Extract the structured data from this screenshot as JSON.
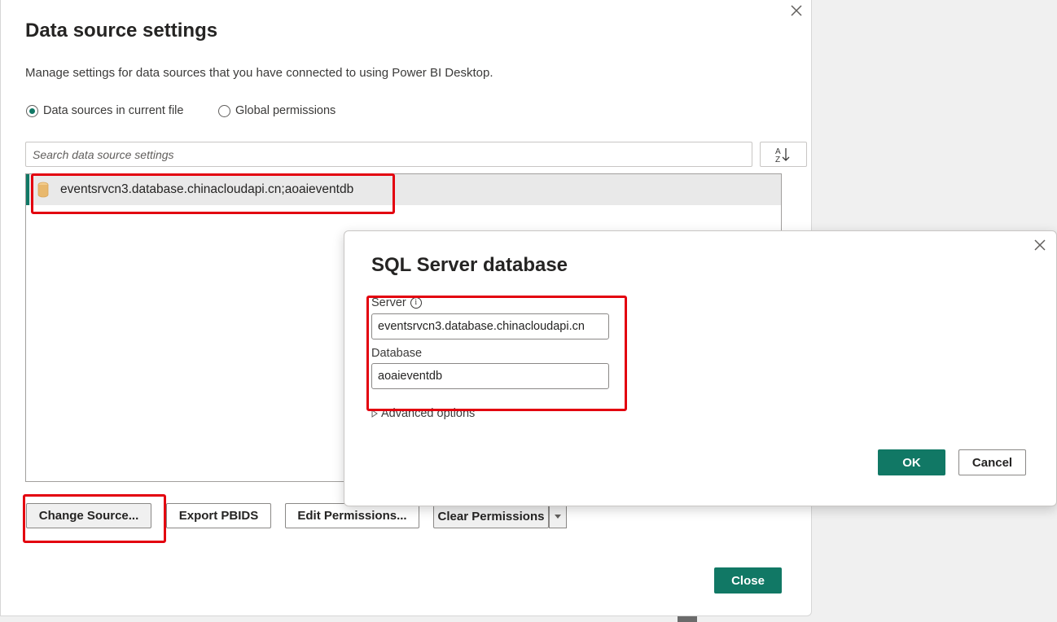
{
  "main_dialog": {
    "title": "Data source settings",
    "description": "Manage settings for data sources that you have connected to using Power BI Desktop.",
    "scope_options": [
      {
        "label": "Data sources in current file",
        "selected": true
      },
      {
        "label": "Global permissions",
        "selected": false
      }
    ],
    "search": {
      "placeholder": "Search data source settings",
      "value": ""
    },
    "sources": [
      {
        "label": "eventsrvcn3.database.chinacloudapi.cn;aoaieventdb",
        "selected": true
      }
    ],
    "buttons": {
      "change_source": "Change Source...",
      "export_pbids": "Export PBIDS",
      "edit_permissions": "Edit Permissions...",
      "clear_permissions": "Clear Permissions",
      "close": "Close"
    }
  },
  "sql_dialog": {
    "title": "SQL Server database",
    "server_label": "Server",
    "server_value": "eventsrvcn3.database.chinacloudapi.cn",
    "database_label": "Database",
    "database_value": "aoaieventdb",
    "advanced_label": "Advanced options",
    "ok": "OK",
    "cancel": "Cancel"
  },
  "colors": {
    "accent": "#117865",
    "highlight": "#e3000f",
    "db_icon": "#e8b86d"
  },
  "icons": [
    "close-icon",
    "sort-az-icon",
    "database-icon",
    "info-icon",
    "expand-triangle-icon",
    "dropdown-arrow-icon"
  ]
}
